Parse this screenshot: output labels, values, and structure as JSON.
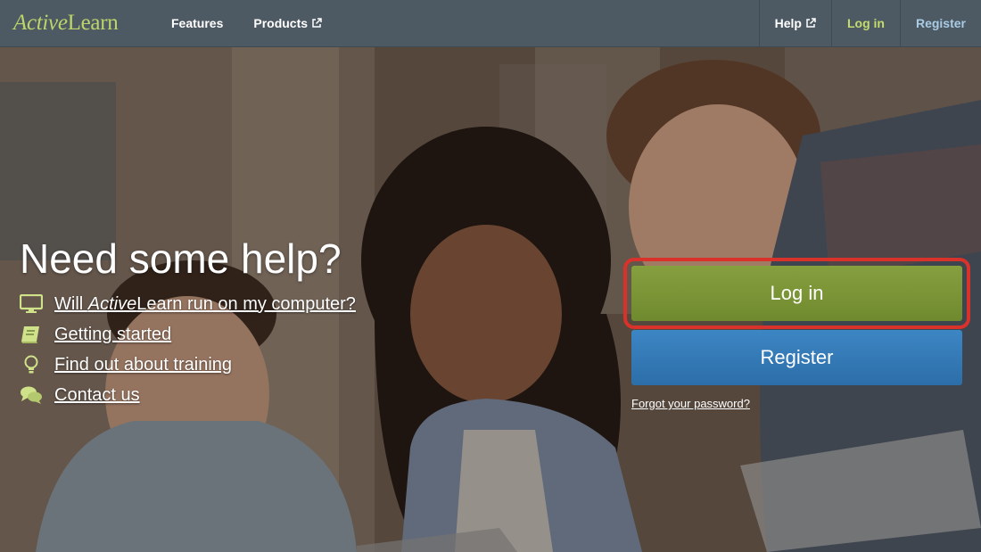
{
  "navbar": {
    "logo_part1": "Active",
    "logo_part2": "Learn",
    "left_links": [
      {
        "label": "Features",
        "external": false
      },
      {
        "label": "Products",
        "external": true
      }
    ],
    "right_links": {
      "help": "Help",
      "login": "Log in",
      "register": "Register"
    }
  },
  "help": {
    "title": "Need some help?",
    "items": [
      {
        "icon": "monitor-icon",
        "pre": "Will ",
        "emph": "Active",
        "post": "Learn run on my computer?"
      },
      {
        "icon": "book-icon",
        "pre": "Getting started",
        "emph": "",
        "post": ""
      },
      {
        "icon": "lightbulb-icon",
        "pre": "Find out about training",
        "emph": "",
        "post": ""
      },
      {
        "icon": "speech-bubbles-icon",
        "pre": "Contact us",
        "emph": "",
        "post": ""
      }
    ]
  },
  "auth": {
    "login_label": "Log in",
    "register_label": "Register",
    "forgot_label": "Forgot your password?"
  },
  "colors": {
    "navbar": "#4d5a63",
    "logo": "#bcd46a",
    "login_button": "#7a9435",
    "register_button": "#3479b6",
    "highlight": "#d8322a"
  }
}
